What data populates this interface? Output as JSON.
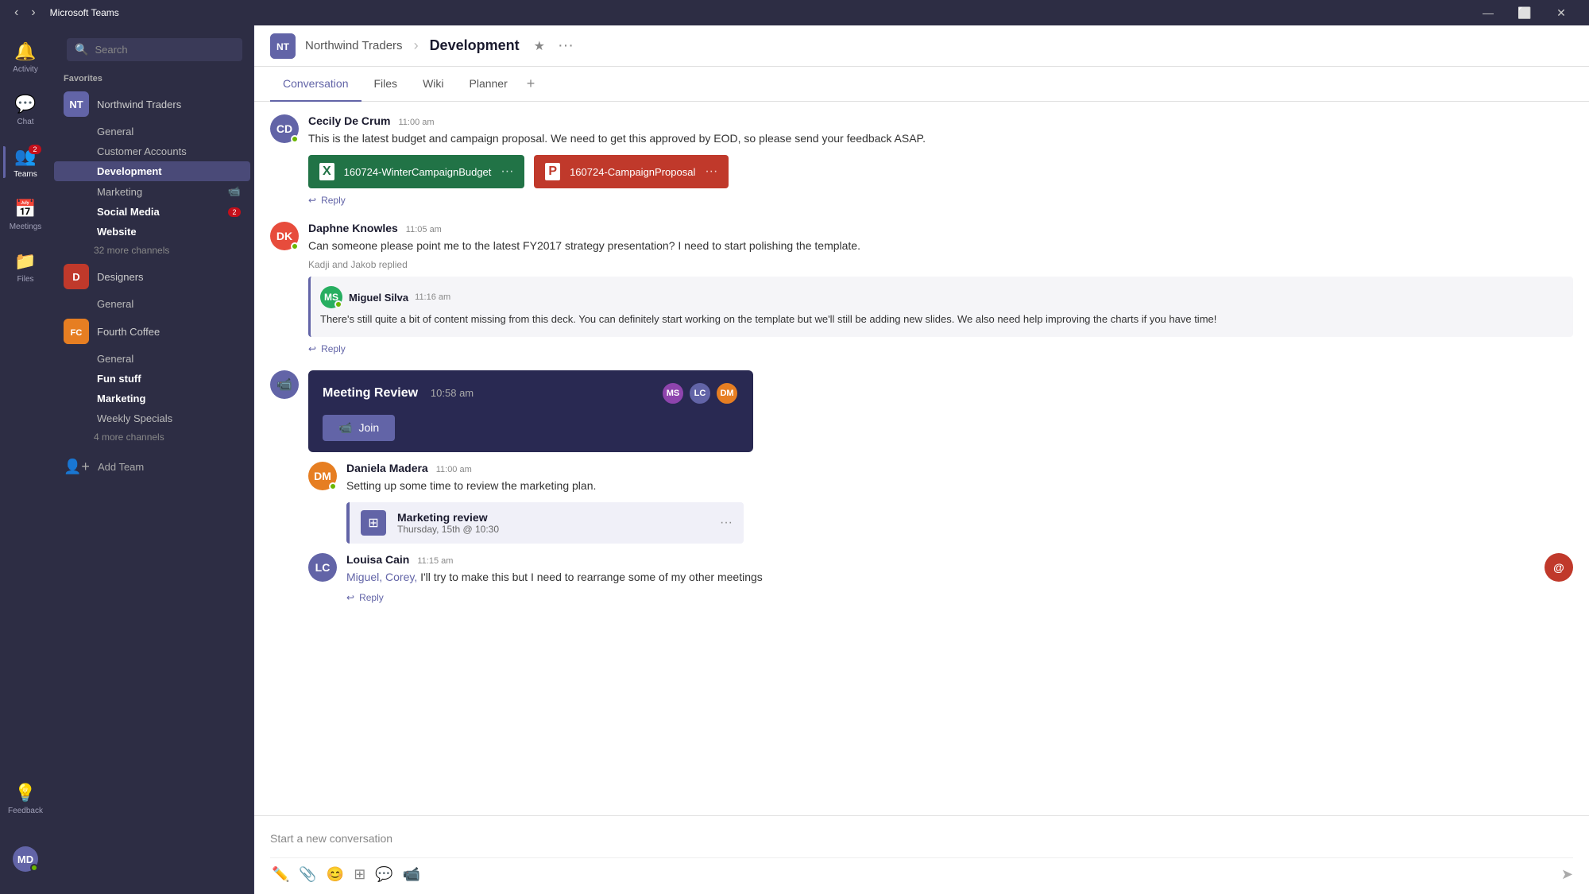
{
  "titlebar": {
    "title": "Microsoft Teams",
    "nav_back": "‹",
    "nav_fwd": "›",
    "btn_minimize": "—",
    "btn_maximize": "⬜",
    "btn_close": "✕"
  },
  "rail": {
    "items": [
      {
        "id": "activity",
        "label": "Activity",
        "icon": "🔔",
        "active": false,
        "badge": null
      },
      {
        "id": "chat",
        "label": "Chat",
        "icon": "💬",
        "active": false,
        "badge": null
      },
      {
        "id": "teams",
        "label": "Teams",
        "icon": "👥",
        "active": true,
        "badge": "2"
      },
      {
        "id": "meetings",
        "label": "Meetings",
        "icon": "📅",
        "active": false,
        "badge": null
      },
      {
        "id": "files",
        "label": "Files",
        "icon": "📁",
        "active": false,
        "badge": null
      }
    ],
    "bottom": {
      "feedback_label": "Feedback",
      "feedback_icon": "💡",
      "user_initials": "MD"
    }
  },
  "sidebar": {
    "search_placeholder": "Search",
    "favorites_label": "Favorites",
    "teams": [
      {
        "id": "northwind",
        "name": "Northwind Traders",
        "avatar_bg": "#6264a7",
        "avatar_text": "NT",
        "channels": [
          {
            "id": "general",
            "name": "General",
            "active": false,
            "badge": null,
            "video": false
          },
          {
            "id": "customer-accounts",
            "name": "Customer Accounts",
            "active": false,
            "badge": null,
            "video": false
          },
          {
            "id": "development",
            "name": "Development",
            "active": true,
            "badge": null,
            "video": false
          },
          {
            "id": "marketing",
            "name": "Marketing",
            "active": false,
            "badge": null,
            "video": true
          },
          {
            "id": "social-media",
            "name": "Social Media",
            "active": false,
            "badge": "2",
            "video": false
          },
          {
            "id": "website",
            "name": "Website",
            "active": false,
            "badge": null,
            "video": false
          }
        ],
        "more_channels": "32 more channels"
      },
      {
        "id": "designers",
        "name": "Designers",
        "avatar_bg": "#c0392b",
        "avatar_text": "D",
        "channels": [
          {
            "id": "general-d",
            "name": "General",
            "active": false,
            "badge": null,
            "video": false
          }
        ],
        "more_channels": null
      },
      {
        "id": "fourth-coffee",
        "name": "Fourth Coffee",
        "avatar_bg": "#e67e22",
        "avatar_text": "FC",
        "channels": [
          {
            "id": "general-fc",
            "name": "General",
            "active": false,
            "badge": null,
            "video": false
          },
          {
            "id": "fun-stuff",
            "name": "Fun stuff",
            "active": false,
            "badge": null,
            "video": false
          },
          {
            "id": "marketing-fc",
            "name": "Marketing",
            "active": false,
            "badge": null,
            "video": false
          },
          {
            "id": "weekly-specials",
            "name": "Weekly Specials",
            "active": false,
            "badge": null,
            "video": false
          }
        ],
        "more_channels": "4 more channels"
      }
    ],
    "add_team_label": "Add Team"
  },
  "header": {
    "org_name": "Northwind Traders",
    "channel_name": "Development",
    "org_avatar_text": "NT",
    "org_avatar_bg": "#6264a7"
  },
  "tabs": [
    {
      "id": "conversation",
      "label": "Conversation",
      "active": true
    },
    {
      "id": "files",
      "label": "Files",
      "active": false
    },
    {
      "id": "wiki",
      "label": "Wiki",
      "active": false
    },
    {
      "id": "planner",
      "label": "Planner",
      "active": false
    }
  ],
  "messages": [
    {
      "id": "msg1",
      "author": "Cecily De Crum",
      "time": "11:00 am",
      "avatar_bg": "#6264a7",
      "avatar_text": "CD",
      "online": true,
      "text": "This is the latest budget and campaign proposal. We need to get this approved by EOD, so please send your feedback ASAP.",
      "attachments": [
        {
          "type": "excel",
          "name": "160724-WinterCampaignBudget"
        },
        {
          "type": "ppt",
          "name": "160724-CampaignProposal"
        }
      ],
      "reply_label": "Reply"
    },
    {
      "id": "msg2",
      "author": "Daphne Knowles",
      "time": "11:05 am",
      "avatar_bg": "#e74c3c",
      "avatar_text": "DK",
      "online": true,
      "text": "Can someone please point me to the latest FY2017 strategy presentation? I need to start polishing the template.",
      "thread_note": "Kadji and Jakob replied",
      "reply": {
        "author": "Miguel Silva",
        "time": "11:16 am",
        "avatar_bg": "#27ae60",
        "avatar_text": "MS",
        "online": true,
        "text": "There's still quite a bit of content missing from this deck. You can definitely start working on the template but we'll still be adding new slides. We also need help improving the charts if you have time!"
      },
      "reply_label": "Reply"
    }
  ],
  "meeting": {
    "title": "Meeting Review",
    "time": "10:58 am",
    "join_label": "Join",
    "participants": [
      {
        "initials": "MS",
        "bg": "#8e44ad"
      },
      {
        "initials": "LC",
        "bg": "#6264a7"
      },
      {
        "initials": "DM",
        "bg": "#e67e22"
      }
    ],
    "messages_after": [
      {
        "id": "meetmsg1",
        "author": "Daniela Madera",
        "time": "11:00 am",
        "avatar_bg": "#e67e22",
        "avatar_text": "DM",
        "online": true,
        "text": "Setting up some time to review the marketing plan.",
        "cal_card": {
          "title": "Marketing review",
          "time": "Thursday, 15th @ 10:30"
        }
      },
      {
        "id": "meetmsg2",
        "author": "Louisa Cain",
        "time": "11:15 am",
        "avatar_bg": "#6264a7",
        "avatar_text": "LC",
        "online": false,
        "mention_text": "Miguel, Corey,",
        "text": " I'll try to make this but I need to rearrange some of my other meetings",
        "reply_label": "Reply",
        "at_icon_bg": "#c0392b"
      }
    ]
  },
  "input": {
    "placeholder": "Start a new conversation",
    "tools": [
      "✏️",
      "📎",
      "😊",
      "⊞",
      "💬",
      "📹"
    ],
    "send_icon": "➤"
  }
}
